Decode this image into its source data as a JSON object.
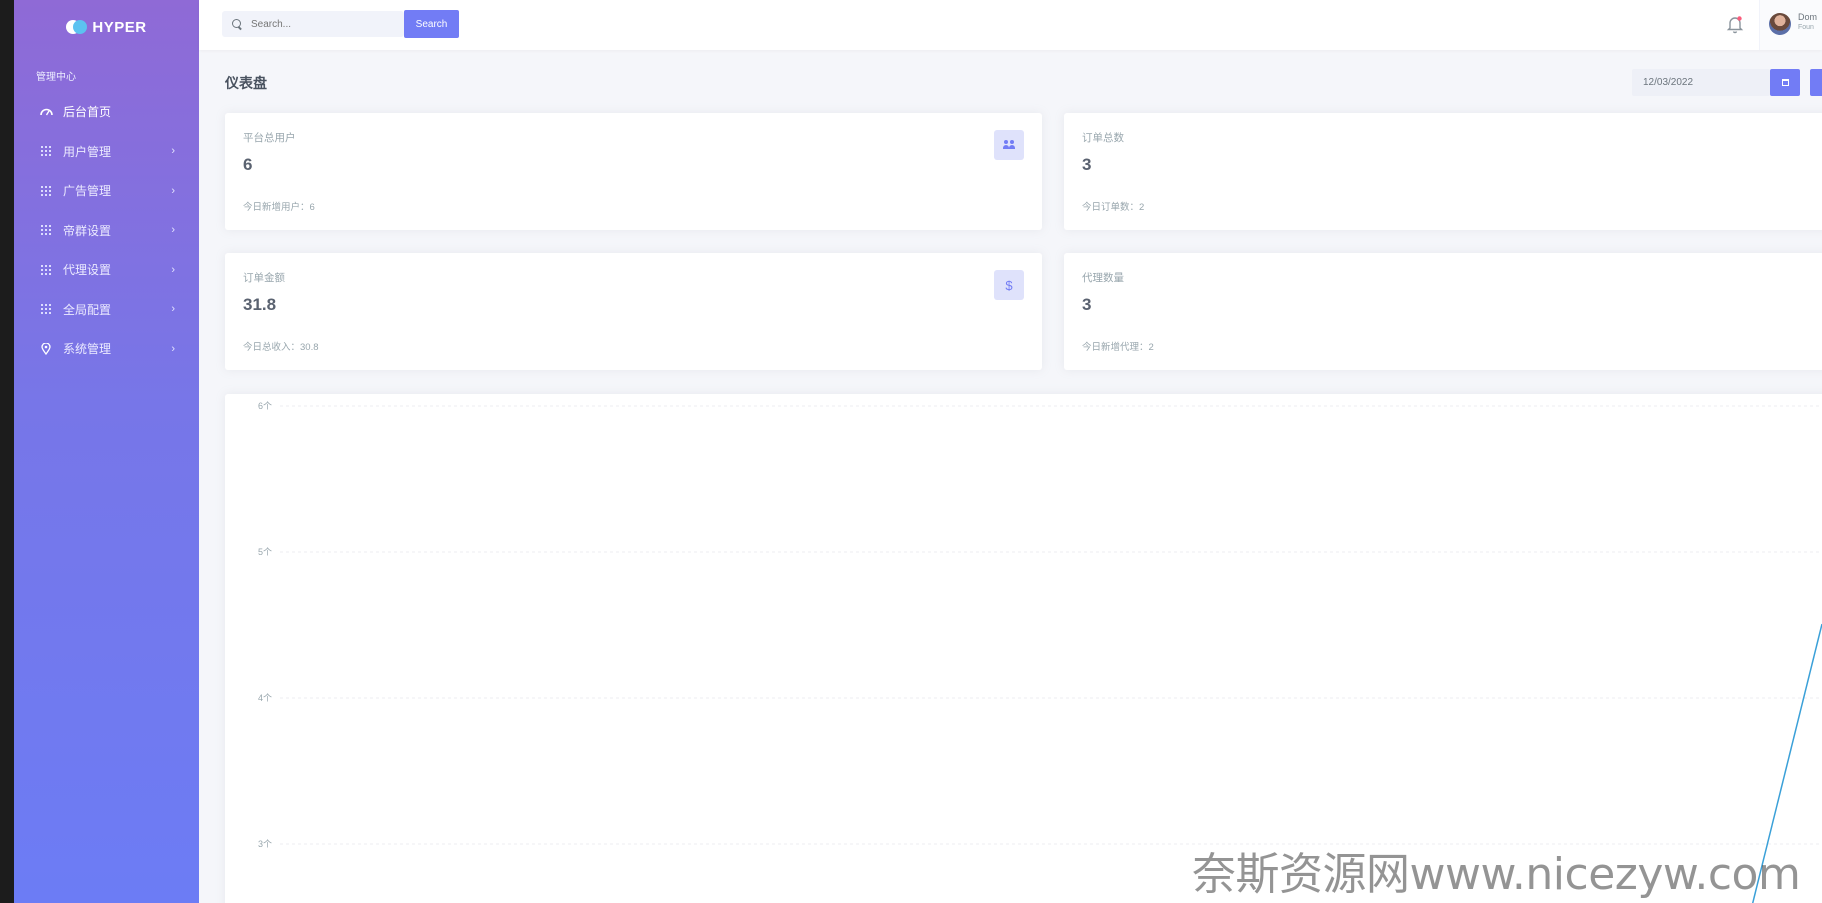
{
  "brand": {
    "name": "HYPER"
  },
  "sidebar": {
    "section_title": "管理中心",
    "items": [
      {
        "label": "后台首页",
        "icon": "dashboard-icon",
        "has_children": false,
        "active": true
      },
      {
        "label": "用户管理",
        "icon": "grid-icon",
        "has_children": true
      },
      {
        "label": "广告管理",
        "icon": "grid-icon",
        "has_children": true
      },
      {
        "label": "帝群设置",
        "icon": "grid-icon",
        "has_children": true
      },
      {
        "label": "代理设置",
        "icon": "grid-icon",
        "has_children": true
      },
      {
        "label": "全局配置",
        "icon": "grid-icon",
        "has_children": true
      },
      {
        "label": "系统管理",
        "icon": "map-pin-icon",
        "has_children": true
      }
    ],
    "chevron": "›"
  },
  "topbar": {
    "search_placeholder": "Search...",
    "search_button": "Search",
    "user_name": "Dom",
    "user_role": "Foun"
  },
  "page": {
    "title": "仪表盘",
    "date": "12/03/2022"
  },
  "stats": [
    {
      "label": "平台总用户",
      "value": "6",
      "sub": "今日新增用户：6",
      "icon": "users-icon"
    },
    {
      "label": "订单总数",
      "value": "3",
      "sub": "今日订单数：2",
      "icon": ""
    },
    {
      "label": "订单金额",
      "value": "31.8",
      "sub": "今日总收入：30.8",
      "icon": "dollar-icon",
      "icon_glyph": "$"
    },
    {
      "label": "代理数量",
      "value": "3",
      "sub": "今日新增代理：2",
      "icon": ""
    }
  ],
  "chart_data": {
    "type": "line",
    "y_ticks": [
      "6个",
      "5个",
      "4个",
      "3个"
    ],
    "ylim": [
      3,
      6
    ],
    "grid": true,
    "series": [
      {
        "values_visible": "line rising steeply near right edge",
        "color": "#3aa0d8"
      }
    ]
  },
  "watermark": "奈斯资源网www.nicezyw.com",
  "colors": {
    "primary": "#727cf5",
    "sidebar_top": "#8f6ad6",
    "sidebar_bottom": "#6c7cf5",
    "line": "#3aa0d8"
  }
}
